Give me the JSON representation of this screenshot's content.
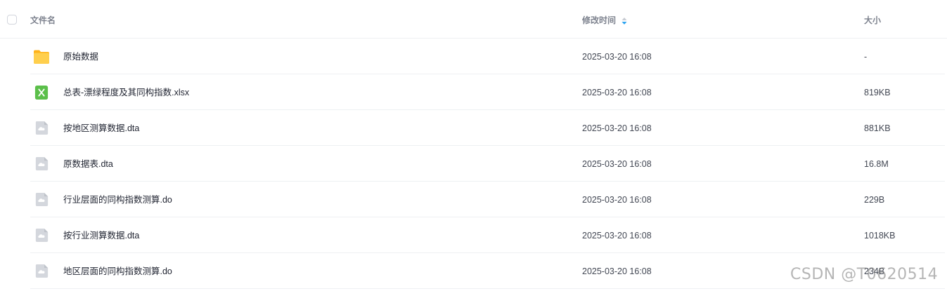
{
  "header": {
    "name_label": "文件名",
    "time_label": "修改时间",
    "size_label": "大小"
  },
  "files": [
    {
      "name": "原始数据",
      "time": "2025-03-20 16:08",
      "size": "-",
      "icon": "folder-icon"
    },
    {
      "name": "总表-漂绿程度及其同构指数.xlsx",
      "time": "2025-03-20 16:08",
      "size": "819KB",
      "icon": "excel-file-icon"
    },
    {
      "name": "按地区测算数据.dta",
      "time": "2025-03-20 16:08",
      "size": "881KB",
      "icon": "generic-file-icon"
    },
    {
      "name": "原数据表.dta",
      "time": "2025-03-20 16:08",
      "size": "16.8M",
      "icon": "generic-file-icon"
    },
    {
      "name": "行业层面的同构指数测算.do",
      "time": "2025-03-20 16:08",
      "size": "229B",
      "icon": "generic-file-icon"
    },
    {
      "name": "按行业测算数据.dta",
      "time": "2025-03-20 16:08",
      "size": "1018KB",
      "icon": "generic-file-icon"
    },
    {
      "name": "地区层面的同构指数测算.do",
      "time": "2025-03-20 16:08",
      "size": "234B",
      "icon": "generic-file-icon"
    }
  ],
  "watermark": "CSDN @T0620514",
  "colors": {
    "sort_accent": "#2fa4f0",
    "folder": "#ffc94d",
    "excel": "#5bbf4a",
    "generic_file": "#cfd3da"
  }
}
